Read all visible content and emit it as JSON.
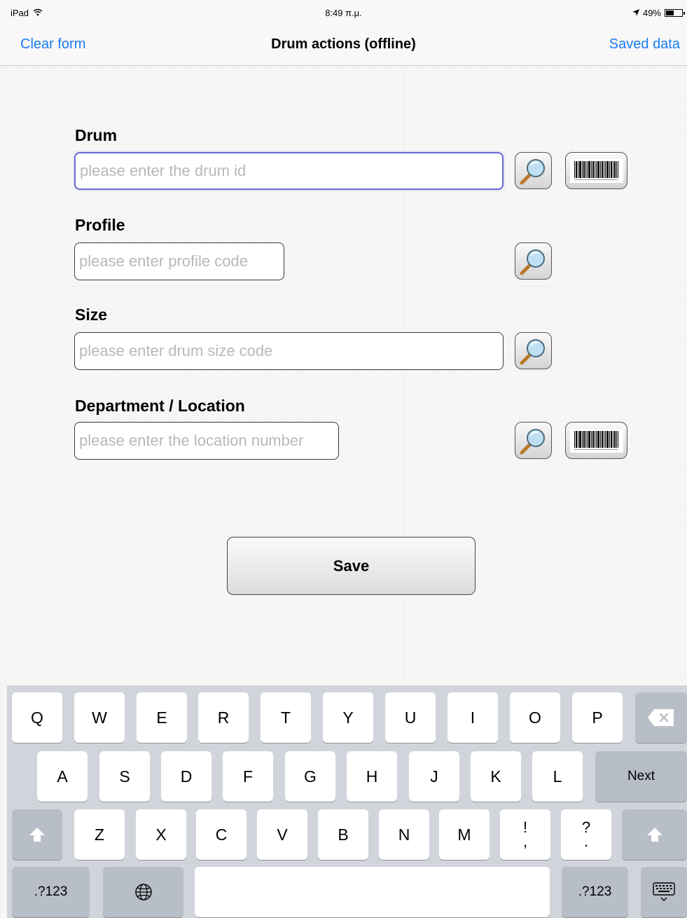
{
  "status_bar": {
    "device": "iPad",
    "time": "8:49 π.μ.",
    "battery_percent": "49%",
    "battery_level": 0.49
  },
  "nav_bar": {
    "left_button": "Clear form",
    "title": "Drum actions (offline)",
    "right_button": "Saved data",
    "accent_color": "#1a7cf4"
  },
  "form": {
    "drum": {
      "label": "Drum",
      "value": "",
      "placeholder": "please enter the drum id"
    },
    "profile": {
      "label": "Profile",
      "value": "",
      "placeholder": "please enter profile code"
    },
    "size": {
      "label": "Size",
      "value": "",
      "placeholder": "please enter drum size code"
    },
    "location": {
      "label": "Department / Location",
      "value": "",
      "placeholder": "please enter the location number"
    },
    "icons": {
      "search": "magnifier-search-icon",
      "barcode": "barcode-scan-icon"
    },
    "save_label": "Save"
  },
  "keyboard": {
    "row1": [
      "Q",
      "W",
      "E",
      "R",
      "T",
      "Y",
      "U",
      "I",
      "O",
      "P"
    ],
    "row2": [
      "A",
      "S",
      "D",
      "F",
      "G",
      "H",
      "J",
      "K",
      "L"
    ],
    "row3": [
      "Z",
      "X",
      "C",
      "V",
      "B",
      "N",
      "M"
    ],
    "exclam_top": "!",
    "exclam_bottom": ",",
    "question_top": "?",
    "question_bottom": ".",
    "next_label": "Next",
    "numbers_label": ".?123",
    "icons": {
      "backspace": "backspace-icon",
      "shift": "shift-icon",
      "globe": "globe-icon",
      "hide_keyboard": "hide-keyboard-icon"
    }
  }
}
